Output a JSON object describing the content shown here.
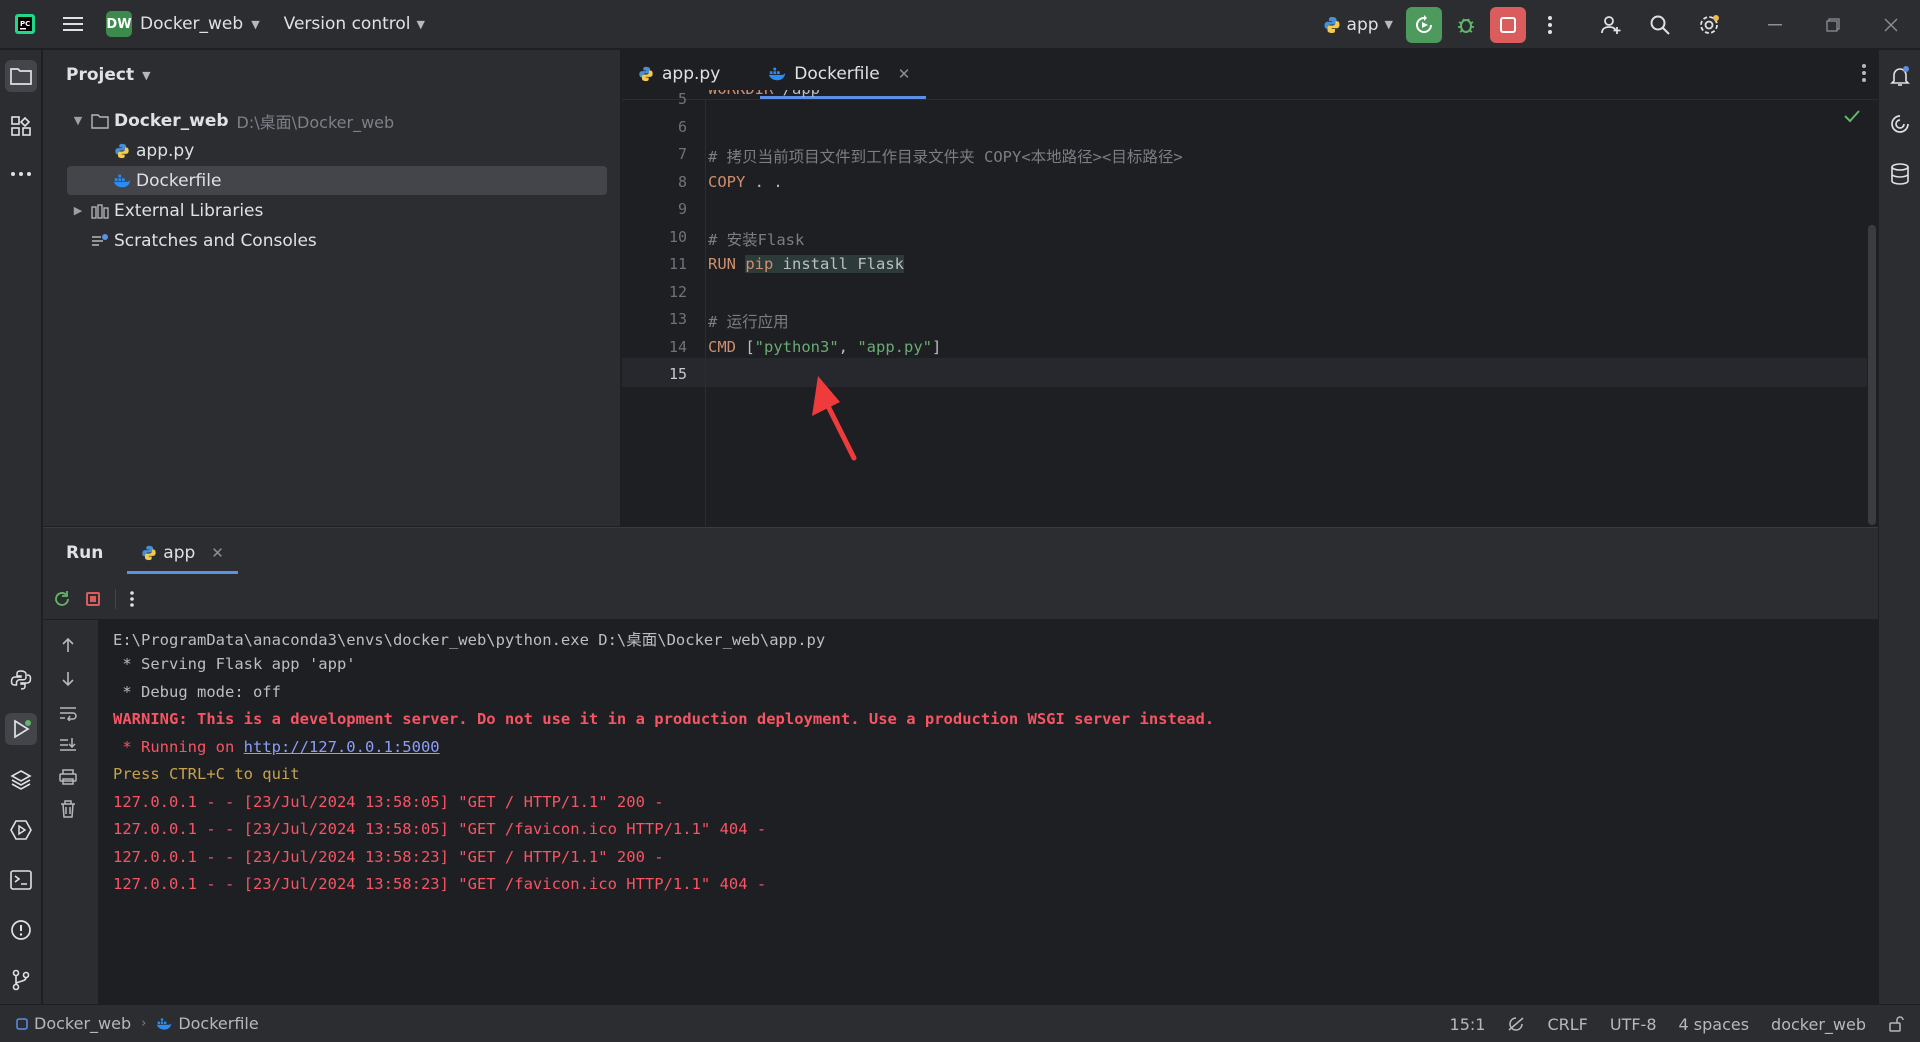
{
  "titlebar": {
    "project_badge": "DW",
    "project_name": "Docker_web",
    "vcs_label": "Version control",
    "run_config": "app"
  },
  "project_panel": {
    "title": "Project",
    "tree": [
      {
        "label": "Docker_web",
        "path": "D:\\桌面\\Docker_web"
      },
      {
        "label": "app.py"
      },
      {
        "label": "Dockerfile"
      },
      {
        "label": "External Libraries"
      },
      {
        "label": "Scratches and Consoles"
      }
    ]
  },
  "editor": {
    "tabs": [
      {
        "label": "app.py"
      },
      {
        "label": "Dockerfile"
      }
    ],
    "line_numbers": [
      "5",
      "6",
      "7",
      "8",
      "9",
      "10",
      "11",
      "12",
      "13",
      "14",
      "15"
    ],
    "lines": {
      "l5_kw": "WORKDIR",
      "l5_rest": " /app",
      "l7": "# 拷贝当前项目文件到工作目录文件夹 COPY<本地路径><目标路径>",
      "l8_kw": "COPY",
      "l8_rest": " . .",
      "l10": "# 安装Flask",
      "l11_kw": "RUN",
      "l11_pip": "pip",
      "l11_rest": " install Flask",
      "l13": "# 运行应用",
      "l14_kw": "CMD",
      "l14_a": " [",
      "l14_s1": "\"python3\"",
      "l14_b": ", ",
      "l14_s2": "\"app.py\"",
      "l14_c": "]"
    }
  },
  "run_panel": {
    "title": "Run",
    "tab": "app",
    "console": {
      "cmd": "E:\\ProgramData\\anaconda3\\envs\\docker_web\\python.exe D:\\桌面\\Docker_web\\app.py",
      "serving": " * Serving Flask app 'app'",
      "debug": " * Debug mode: off",
      "warning": "WARNING: This is a development server. Do not use it in a production deployment. Use a production WSGI server instead.",
      "running_prefix": " * Running on ",
      "running_url": "http://127.0.0.1:5000",
      "quit": "Press CTRL+C to quit",
      "log1": "127.0.0.1 - - [23/Jul/2024 13:58:05] \"GET / HTTP/1.1\" 200 -",
      "log2": "127.0.0.1 - - [23/Jul/2024 13:58:05] \"GET /favicon.ico HTTP/1.1\" 404 -",
      "log3": "127.0.0.1 - - [23/Jul/2024 13:58:23] \"GET / HTTP/1.1\" 200 -",
      "log4": "127.0.0.1 - - [23/Jul/2024 13:58:23] \"GET /favicon.ico HTTP/1.1\" 404 -"
    }
  },
  "statusbar": {
    "crumb_project": "Docker_web",
    "crumb_file": "Dockerfile",
    "position": "15:1",
    "line_sep": "CRLF",
    "encoding": "UTF-8",
    "indent": "4 spaces",
    "interpreter": "docker_web"
  },
  "colors": {
    "accent": "#5c8fe6",
    "rerun": "#4e9a5c",
    "stop": "#db5c5c",
    "arrow": "#ef3b3b"
  }
}
